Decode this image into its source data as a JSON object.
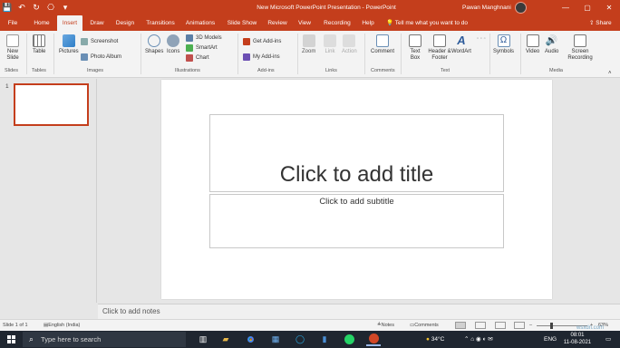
{
  "titlebar": {
    "title": "New Microsoft PowerPoint Presentation - PowerPoint",
    "user": "Pawan Manghnani",
    "qat": [
      "💾",
      "↶",
      "↻",
      "⎔",
      "▾"
    ],
    "controls": [
      "—",
      "▢",
      "✕"
    ]
  },
  "tabs": [
    "File",
    "Home",
    "Insert",
    "Draw",
    "Design",
    "Transitions",
    "Animations",
    "Slide Show",
    "Review",
    "View",
    "Recording",
    "Help"
  ],
  "tell_me": "Tell me what you want to do",
  "share": "Share",
  "ribbon": {
    "new_slide": "New Slide",
    "table": "Table",
    "pictures": "Pictures",
    "screenshot": "Screenshot",
    "photo_album": "Photo Album",
    "shapes": "Shapes",
    "icons": "Icons",
    "models_3d": "3D Models",
    "smartart": "SmartArt",
    "chart": "Chart",
    "get_addins": "Get Add-ins",
    "my_addins": "My Add-ins",
    "zoom": "Zoom",
    "link": "Link",
    "action": "Action",
    "comment": "Comment",
    "text_box": "Text Box",
    "header_footer": "Header & Footer",
    "wordart": "WordArt",
    "symbols": "Symbols",
    "video": "Video",
    "audio": "Audio",
    "screen_recording": "Screen Recording",
    "groups": [
      "Slides",
      "Tables",
      "Images",
      "Illustrations",
      "Add-ins",
      "Links",
      "Comments",
      "Text",
      "Media"
    ]
  },
  "slide": {
    "number": "1",
    "title_placeholder": "Click to add title",
    "subtitle_placeholder": "Click to add subtitle"
  },
  "notes_placeholder": "Click to add notes",
  "status": {
    "slide_info": "Slide 1 of 1",
    "language": "English (India)",
    "notes": "Notes",
    "comments": "Comments",
    "zoom": "63%"
  },
  "taskbar": {
    "search_placeholder": "Type here to search",
    "weather": "34°C",
    "lang": "ENG",
    "time": "08:01",
    "date": "11-08-2021"
  },
  "watermark": "wsxdn.com",
  "colors": {
    "accent": "#c43e1c",
    "taskbar": "#1f2630"
  }
}
